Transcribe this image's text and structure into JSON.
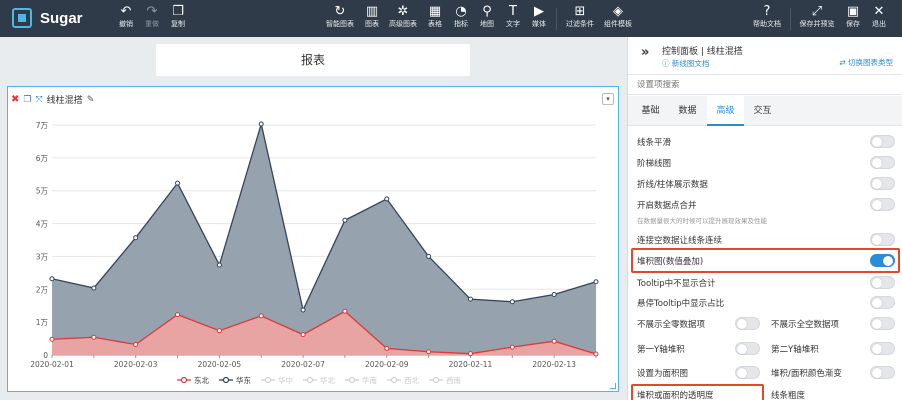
{
  "app": {
    "name": "Sugar"
  },
  "toolbar": {
    "undo": "撤销",
    "redo": "重做",
    "copy": "复制",
    "smart_chart": "智能图表",
    "chart": "图表",
    "advanced_chart": "高级图表",
    "table": "表格",
    "indicator": "指标",
    "map": "地图",
    "text": "文字",
    "media": "媒体",
    "filter": "过滤条件",
    "component_template": "组件模板",
    "help": "帮助文档",
    "save_preview": "保存并预览",
    "save": "保存",
    "exit": "退出"
  },
  "report": {
    "title": "报表"
  },
  "widget": {
    "title": "线柱混搭"
  },
  "panel": {
    "title": "控制面板 | 线柱混搭",
    "new_doc": "新线图文档",
    "switch_type": "切换图表类型",
    "search_placeholder": "设置项搜索",
    "tabs": [
      "基础",
      "数据",
      "高级",
      "交互"
    ],
    "options": {
      "smooth": "线条平滑",
      "step": "阶梯线图",
      "show_data": "折线/柱体展示数据",
      "merge_points": "开启数据点合并",
      "merge_hint": "在数据量很大的时候可以提升展现效果及性能",
      "connect_null": "连接空数据让线条连续",
      "stacked": "堆积图(数值叠加)",
      "tooltip_no_total": "Tooltip中不显示合计",
      "tooltip_percent": "悬停Tooltip中显示占比",
      "hide_zero": "不展示全零数据项",
      "hide_empty": "不展示全空数据项",
      "y1_stack": "第一Y轴堆积",
      "y2_stack": "第二Y轴堆积",
      "area": "设置为面积图",
      "gradient": "堆积/面积颜色渐变",
      "opacity": "堆积或面积的透明度",
      "line_width": "线条粗度"
    }
  },
  "colors": {
    "accent": "#2b8cd8",
    "highlight": "#e04a2a",
    "series_north": "#d93a3a",
    "series_east": "#33455a"
  },
  "chart_data": {
    "type": "area",
    "stacked": true,
    "x": [
      "2020-02-01",
      "2020-02-02",
      "2020-02-03",
      "2020-02-04",
      "2020-02-05",
      "2020-02-06",
      "2020-02-07",
      "2020-02-08",
      "2020-02-09",
      "2020-02-10",
      "2020-02-11",
      "2020-02-12",
      "2020-02-13",
      "2020-02-14"
    ],
    "xticks": [
      "2020-02-01",
      "2020-02-03",
      "2020-02-05",
      "2020-02-07",
      "2020-02-09",
      "2020-02-11",
      "2020-02-13"
    ],
    "yticks": [
      "0",
      "1万",
      "2万",
      "3万",
      "4万",
      "5万",
      "6万",
      "7万"
    ],
    "ylim": [
      0,
      70000
    ],
    "series": [
      {
        "name": "东北",
        "color": "#d93a3a",
        "fill": "#e8a3a3",
        "values": [
          4800,
          5400,
          3200,
          12300,
          7400,
          11900,
          6200,
          13300,
          2000,
          1000,
          400,
          2400,
          4200,
          300
        ]
      },
      {
        "name": "华东",
        "color": "#33455a",
        "fill": "#96a2ad",
        "values": [
          18400,
          15000,
          32500,
          40000,
          20000,
          58400,
          7500,
          27700,
          45500,
          29000,
          16600,
          13800,
          14200,
          22000
        ]
      }
    ],
    "legend": [
      "东北",
      "华东",
      "华中",
      "华北",
      "华南",
      "西北",
      "西南"
    ],
    "legend_active": 2,
    "legend_position": "bottom-center",
    "grid": true
  }
}
